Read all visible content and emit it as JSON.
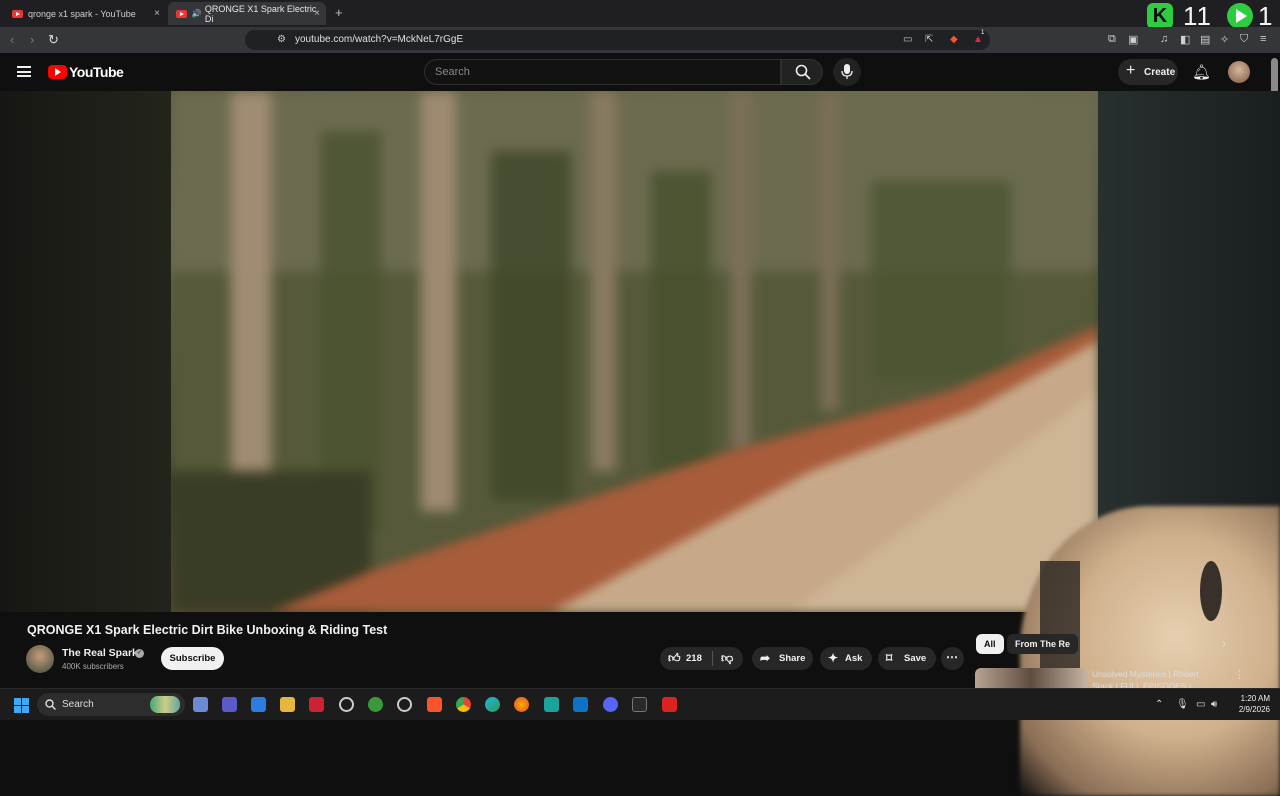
{
  "browser": {
    "tabs": [
      {
        "label": "qronge x1 spark - YouTube",
        "active": false
      },
      {
        "label": "QRONGE X1 Spark Electric Di",
        "active": true
      }
    ],
    "new_tab": "+",
    "close": "×",
    "url": "youtube.com/watch?v=MckNeL7rGgE",
    "shields_badge": "1"
  },
  "overlay": {
    "k_letter": "K",
    "k_count": "11",
    "play_count": "1"
  },
  "youtube": {
    "logo_text": "YouTube",
    "search_placeholder": "Search",
    "create_label": "Create",
    "video": {
      "title": "QRONGE X1 Spark Electric Dirt Bike Unboxing & Riding Test",
      "channel": "The Real Spark",
      "subscribers": "400K subscribers",
      "subscribe_label": "Subscribe",
      "likes": "218",
      "share_label": "Share",
      "ask_label": "Ask",
      "save_label": "Save"
    },
    "chips": [
      "All",
      "From The Re"
    ],
    "recommendation": {
      "title": "Unsolved Mysteries | Robert Stack | FULL EPISODES |"
    }
  },
  "taskbar": {
    "search_label": "Search",
    "time": "1:20 AM",
    "date": "2/9/2026"
  },
  "colors": {
    "accent_red": "#ff0000",
    "overlay_green": "#2ecc40",
    "background": "#0f0f0f"
  }
}
